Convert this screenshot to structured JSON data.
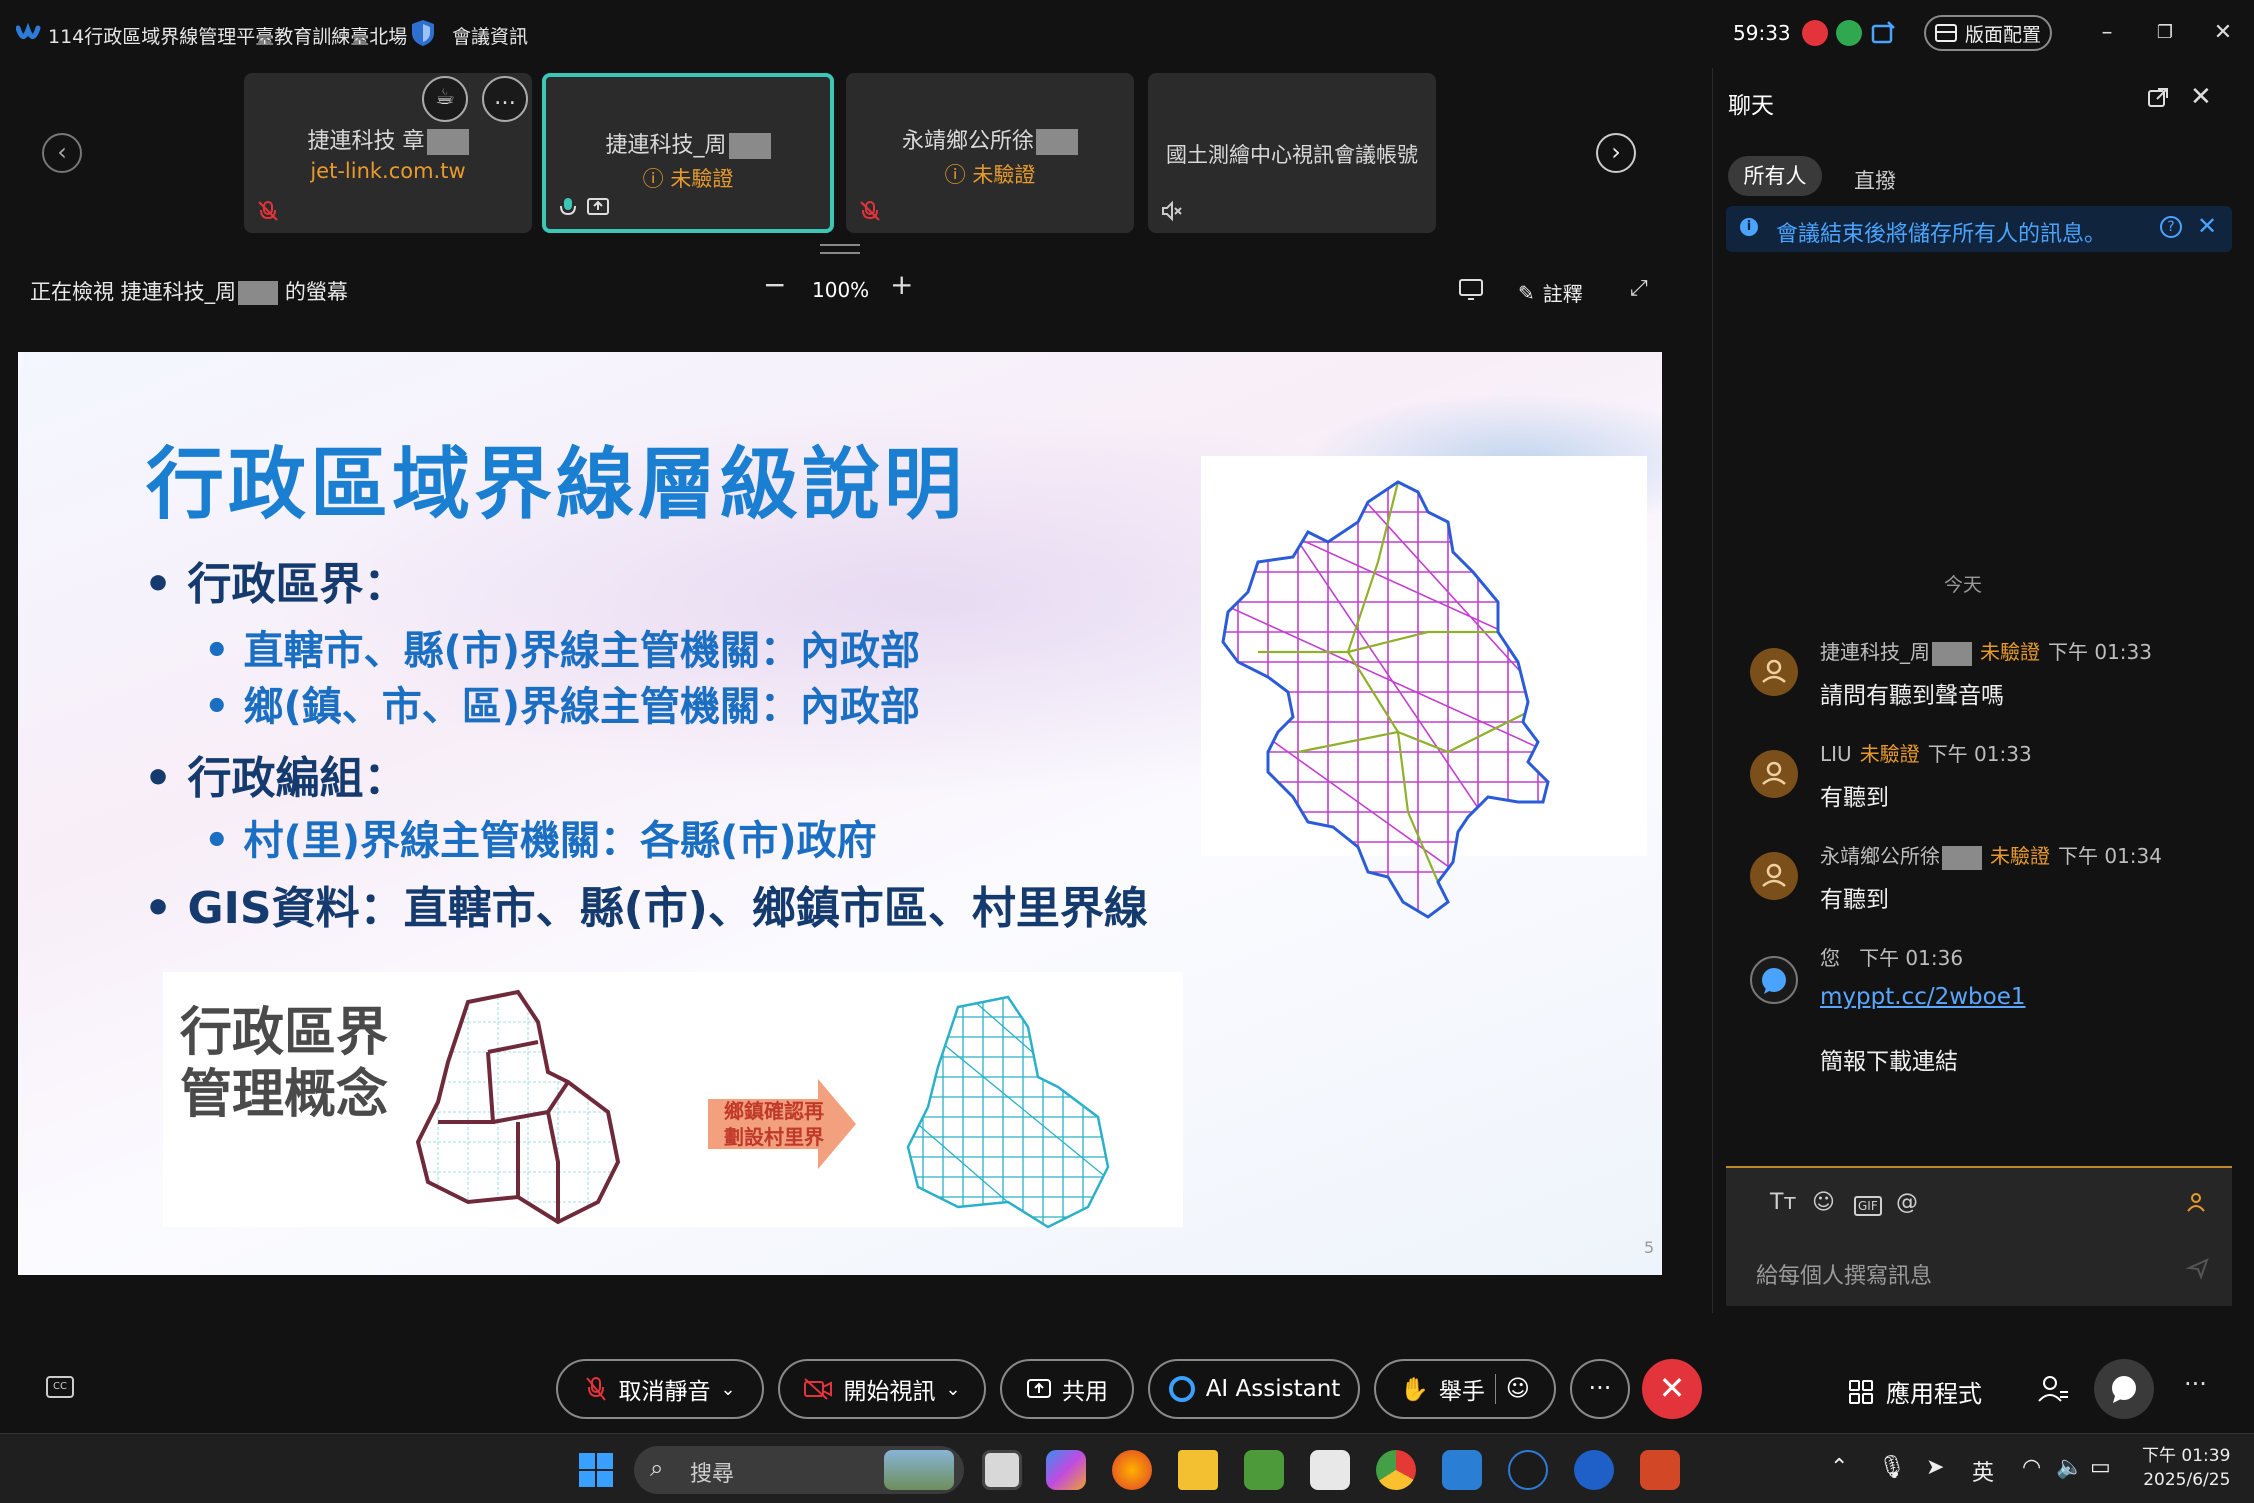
{
  "titlebar": {
    "meeting_title": "114行政區域界線管理平臺教育訓練臺北場",
    "meeting_info": "會議資訊",
    "timer": "59:33",
    "layout_label": "版面配置"
  },
  "participants": [
    {
      "name": "捷連科技 章",
      "subtitle": "jet-link.com.tw",
      "subtitle_color": "#e89a2c"
    },
    {
      "name": "捷連科技_周",
      "subtitle": "未驗證",
      "active": true
    },
    {
      "name": "永靖鄉公所徐",
      "subtitle": "未驗證"
    },
    {
      "name": "國土測繪中心視訊會議帳號",
      "subtitle": ""
    }
  ],
  "viewing": {
    "label_prefix": "正在檢視 捷連科技_周",
    "label_suffix": "的螢幕",
    "zoom": "100%",
    "annotate_label": "註釋"
  },
  "slide": {
    "title": "行政區域界線層級說明",
    "bullets": [
      "• 行政區界：",
      "• 直轄市、縣(市)界線主管機關：內政部",
      "• 鄉(鎮、市、區)界線主管機關：內政部",
      "• 行政編組：",
      "• 村(里)界線主管機關：各縣(市)政府",
      "• GIS資料：直轄市、縣(市)、鄉鎮市區、村里界線"
    ],
    "concept_title_line1": "行政區界",
    "concept_title_line2": "管理概念",
    "arrow_line1": "鄉鎮確認再",
    "arrow_line2": "劃設村里界",
    "page_number": "5"
  },
  "chat": {
    "title": "聊天",
    "tab_all": "所有人",
    "tab_direct": "直撥",
    "notice": "會議結束後將儲存所有人的訊息。",
    "day_divider": "今天",
    "messages": [
      {
        "sender": "捷連科技_周",
        "badge": "未驗證",
        "time": "下午 01:33",
        "text": "請問有聽到聲音嗎"
      },
      {
        "sender": "LIU",
        "badge": "未驗證",
        "time": "下午 01:33",
        "text": "有聽到"
      },
      {
        "sender": "永靖鄉公所徐",
        "badge": "未驗證",
        "time": "下午 01:34",
        "text": "有聽到"
      },
      {
        "sender": "您",
        "badge": "",
        "time": "下午 01:36",
        "link": "myppt.cc/2wboe1",
        "text": "簡報下載連結"
      }
    ],
    "composer_placeholder": "給每個人撰寫訊息"
  },
  "toolbar": {
    "unmute": "取消靜音",
    "start_video": "開始視訊",
    "share": "共用",
    "ai_assistant": "AI Assistant",
    "raise_hand": "舉手",
    "apps": "應用程式"
  },
  "taskbar": {
    "search_placeholder": "搜尋",
    "ime": "英",
    "time": "下午 01:39",
    "date": "2025/6/25"
  },
  "colors": {
    "accent_teal": "#3bc6b5",
    "unverified_orange": "#e89a2c",
    "end_red": "#e3333b",
    "link_blue": "#5aa6ff",
    "slide_title_blue": "#1a7fd0"
  }
}
